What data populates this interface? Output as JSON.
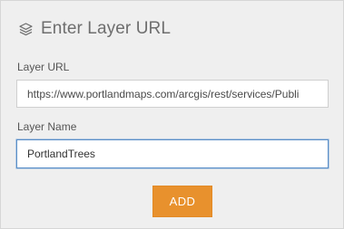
{
  "header": {
    "icon": "layers-icon",
    "title": "Enter Layer URL"
  },
  "form": {
    "url_label": "Layer URL",
    "url_value": "https://www.portlandmaps.com/arcgis/rest/services/Publi",
    "name_label": "Layer Name",
    "name_value": "PortlandTrees",
    "add_button_label": "ADD"
  },
  "colors": {
    "panel_background": "#efefef",
    "accent_button": "#e8912d",
    "focus_border": "#5a8fc8"
  }
}
